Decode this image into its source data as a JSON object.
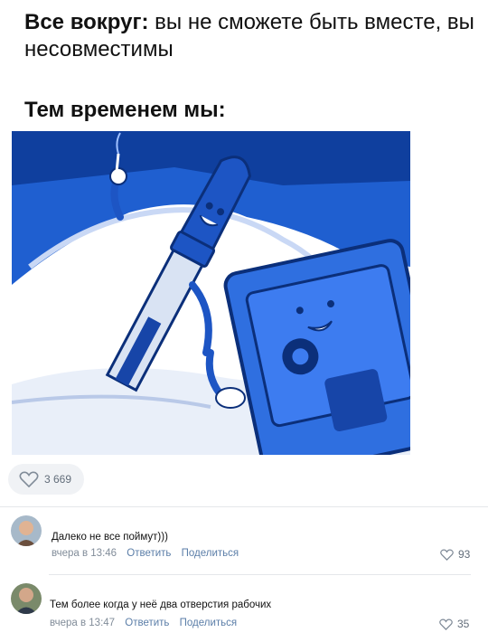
{
  "post": {
    "headline_bold": "Все вокруг:",
    "headline_rest": " вы не сможете быть вместе, вы несовместимы",
    "subhead": "Тем временем мы:",
    "likes": "3 669"
  },
  "comments": [
    {
      "text": "Далеко не все поймут)))",
      "time": "вчера в 13:46",
      "reply": "Ответить",
      "share": "Поделиться",
      "likes": "93"
    },
    {
      "text": "Тем более когда у неё два отверстия рабочих",
      "time": "вчера в 13:47",
      "reply": "Ответить",
      "share": "Поделиться",
      "likes": "35"
    }
  ],
  "colors": {
    "accent_link": "#5b7ea8",
    "muted": "#818c99",
    "image_blue": "#1a57c6"
  },
  "icons": [
    "heart-icon"
  ]
}
